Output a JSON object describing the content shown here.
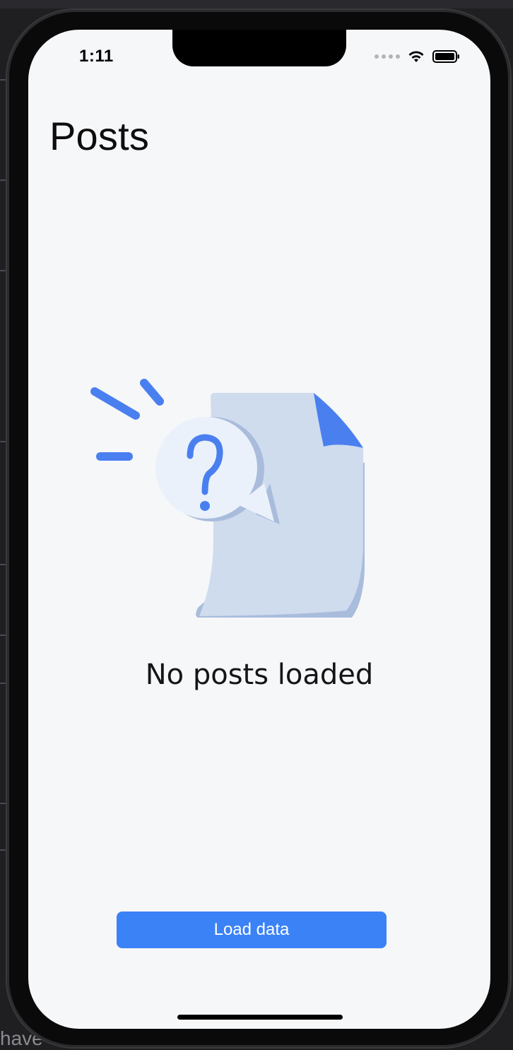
{
  "status_bar": {
    "time": "1:11",
    "wifi_icon": "wifi-icon",
    "battery_icon": "battery-icon"
  },
  "header": {
    "title": "Posts"
  },
  "empty_state": {
    "illustration_icon": "question-document-icon",
    "message": "No posts loaded"
  },
  "actions": {
    "load_label": "Load data"
  },
  "background": {
    "partial_text": "have"
  },
  "colors": {
    "accent": "#3b82f6",
    "illustration_blue": "#4a7ff0",
    "document_fill": "#cfdcee",
    "screen_bg": "#f6f7f9"
  }
}
